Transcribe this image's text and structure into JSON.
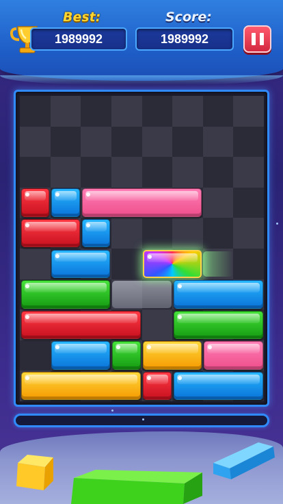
{
  "header": {
    "best_label": "Best:",
    "best_value": "1989992",
    "score_label": "Score:",
    "score_value": "1989992",
    "trophy_icon": "trophy-icon",
    "pause_icon": "pause-icon"
  },
  "board": {
    "columns": 8,
    "rows": 10,
    "blocks": [
      {
        "color": "red",
        "row": 3,
        "col": 0,
        "len": 1
      },
      {
        "color": "blue",
        "row": 3,
        "col": 1,
        "len": 1
      },
      {
        "color": "pink",
        "row": 3,
        "col": 2,
        "len": 4
      },
      {
        "color": "red",
        "row": 4,
        "col": 0,
        "len": 2
      },
      {
        "color": "blue",
        "row": 4,
        "col": 2,
        "len": 1
      },
      {
        "color": "blue",
        "row": 5,
        "col": 1,
        "len": 2
      },
      {
        "color": "rainbow",
        "row": 5,
        "col": 4,
        "len": 2
      },
      {
        "color": "green",
        "row": 6,
        "col": 0,
        "len": 3
      },
      {
        "color": "blue",
        "row": 6,
        "col": 5,
        "len": 3
      },
      {
        "color": "red",
        "row": 7,
        "col": 0,
        "len": 4
      },
      {
        "color": "green",
        "row": 7,
        "col": 5,
        "len": 3
      },
      {
        "color": "blue",
        "row": 8,
        "col": 1,
        "len": 2
      },
      {
        "color": "green",
        "row": 8,
        "col": 3,
        "len": 1
      },
      {
        "color": "yellow",
        "row": 8,
        "col": 4,
        "len": 2
      },
      {
        "color": "pink",
        "row": 8,
        "col": 6,
        "len": 2
      },
      {
        "color": "yellow",
        "row": 9,
        "col": 0,
        "len": 4
      },
      {
        "color": "red",
        "row": 9,
        "col": 4,
        "len": 1
      },
      {
        "color": "blue",
        "row": 9,
        "col": 5,
        "len": 3
      }
    ],
    "ghost": {
      "row": 6,
      "col": 3,
      "len": 2
    },
    "trail": {
      "row": 5,
      "col": 6,
      "len": 1
    }
  },
  "progress": {
    "fraction": 0.0
  },
  "colors": {
    "accent": "#2f8bff",
    "best_label": "#ffd530",
    "pause_button": "#e8384f"
  }
}
